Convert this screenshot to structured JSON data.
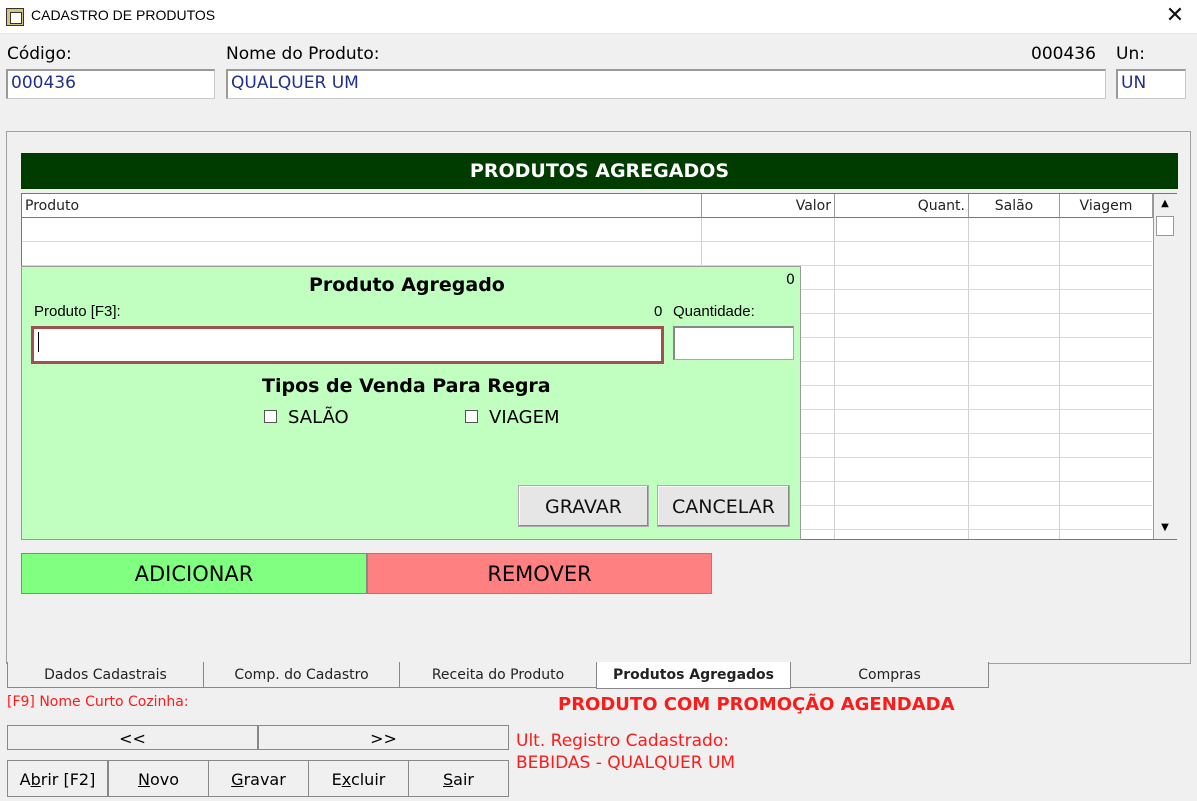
{
  "window": {
    "title": "CADASTRO DE PRODUTOS"
  },
  "header": {
    "codigo_label": "Código:",
    "codigo_value": "000436",
    "nome_label": "Nome do Produto:",
    "nome_value": "QUALQUER UM",
    "code_display": "000436",
    "un_label": "Un:",
    "un_value": "UN"
  },
  "agregados": {
    "title": "PRODUTOS AGREGADOS",
    "columns": [
      "Produto",
      "Valor",
      "Quant.",
      "Salão",
      "Viagem"
    ]
  },
  "dialog": {
    "title": "Produto Agregado",
    "counter": "0",
    "produto_label": "Produto [F3]:",
    "produto_code": "0",
    "quantidade_label": "Quantidade:",
    "tipos_title": "Tipos de Venda Para Regra",
    "salao_label": "SALÃO",
    "viagem_label": "VIAGEM",
    "gravar_label": "GRAVAR",
    "cancelar_label": "CANCELAR"
  },
  "actions": {
    "adicionar": "ADICIONAR",
    "remover": "REMOVER"
  },
  "tabs": [
    "Dados Cadastrais",
    "Comp. do Cadastro",
    "Receita do Produto",
    "Produtos Agregados",
    "Compras"
  ],
  "footer": {
    "f9_text": "[F9] Nome Curto Cozinha:",
    "promo_text": "PRODUTO COM PROMOÇÃO AGENDADA",
    "prev_label": "<<",
    "next_label": ">>",
    "ult_label": "Ult. Registro Cadastrado:",
    "ult_value": "BEBIDAS - QUALQUER UM",
    "buttons": {
      "abrir_pre": "A",
      "abrir_u": "b",
      "abrir_post": "rir [F2]",
      "novo_u": "N",
      "novo_post": "ovo",
      "gravar_u": "G",
      "gravar_post": "ravar",
      "excluir_pre": "E",
      "excluir_u": "x",
      "excluir_post": "cluir",
      "sair_u": "S",
      "sair_post": "air"
    }
  },
  "colors": {
    "header_green": "#003c00",
    "dialog_bg": "#c0ffc0",
    "add_green": "#80ff80",
    "remove_red": "#ff8080",
    "alert_red": "#ff1a1a",
    "value_blue": "#1f2f8f"
  }
}
